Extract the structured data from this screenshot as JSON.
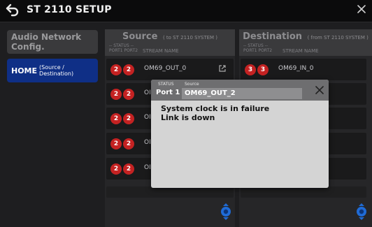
{
  "header": {
    "title": "ST 2110 SETUP"
  },
  "sidebar": {
    "items": [
      {
        "label": "Audio Network Config."
      },
      {
        "label": "HOME",
        "sub": "(Source / Destination)"
      }
    ]
  },
  "source": {
    "title": "Source",
    "subtitle": "( to ST 2110 SYSTEM )",
    "status_label": "-- STATUS --",
    "ports_label": "PORT1 PORT2",
    "stream_label": "STREAM NAME",
    "rows": [
      {
        "p1": "2",
        "p2": "2",
        "name": "OM69_OUT_0"
      },
      {
        "p1": "2",
        "p2": "2",
        "name": "OI"
      },
      {
        "p1": "2",
        "p2": "2",
        "name": "OI"
      },
      {
        "p1": "2",
        "p2": "2",
        "name": "OI"
      },
      {
        "p1": "2",
        "p2": "2",
        "name": "OI"
      }
    ]
  },
  "destination": {
    "title": "Destination",
    "subtitle": "( from ST 2110 SYSTEM )",
    "status_label": "-- STATUS --",
    "ports_label": "PORT1 PORT2",
    "stream_label": "STREAM NAME",
    "rows": [
      {
        "p1": "3",
        "p2": "3",
        "name": "OM69_IN_0"
      }
    ]
  },
  "dialog": {
    "status_label": "STATUS",
    "source_label": "Source",
    "port": "Port 1",
    "source_value": "OM69_OUT_2",
    "messages": [
      "System clock is in failure",
      "Link is down"
    ]
  },
  "colors": {
    "accent": "#0f2f86",
    "badge": "#c42222",
    "scroll": "#1f6bd6"
  }
}
